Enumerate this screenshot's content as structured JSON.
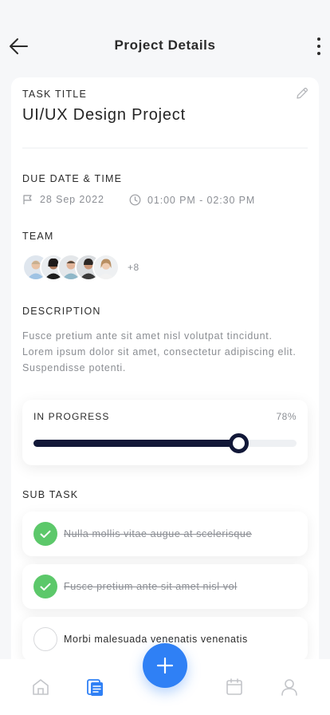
{
  "header": {
    "title": "Project Details"
  },
  "task": {
    "label": "TASK TITLE",
    "title": "UI/UX Design Project"
  },
  "due": {
    "label": "DUE DATE & TIME",
    "date": "28 Sep 2022",
    "time": "01:00 PM - 02:30 PM"
  },
  "team": {
    "label": "TEAM",
    "more": "+8"
  },
  "description": {
    "label": "DESCRIPTION",
    "text": "Fusce pretium ante sit amet nisl volutpat tincidunt. Lorem ipsum dolor sit amet, consectetur adipiscing elit. Suspendisse potenti."
  },
  "progress": {
    "label": "IN PROGRESS",
    "percent_text": "78%",
    "value": 0.78
  },
  "subtasks": {
    "label": "SUB TASK",
    "items": [
      {
        "text": "Nulla mollis vitae augue at scelerisque",
        "done": true
      },
      {
        "text": "Fusce pretium ante sit amet nisl vol",
        "done": true
      },
      {
        "text": "Morbi malesuada venenatis venenatis",
        "done": false
      }
    ]
  },
  "icons": {
    "back": "arrow-left-icon",
    "more": "more-vertical-icon",
    "edit": "pencil-icon",
    "date": "flag-icon",
    "time": "clock-icon",
    "check": "check-icon",
    "nav": [
      "home-icon",
      "tasks-icon",
      "calendar-icon",
      "profile-icon"
    ],
    "fab": "plus-icon"
  },
  "colors": {
    "accent": "#2f80f5",
    "progress": "#121838",
    "done": "#5cc86a"
  }
}
